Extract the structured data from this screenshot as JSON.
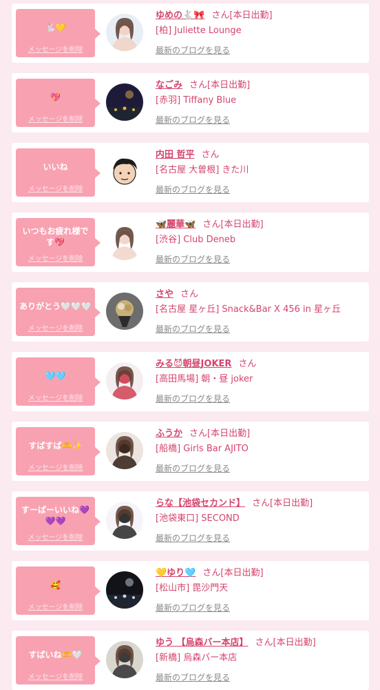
{
  "messages": [
    {
      "message": "🐇💛",
      "name": "ゆめの🐇🎀",
      "honorific": "さん",
      "status": "[本日出勤]",
      "shop": "[柏] Juliette Lounge",
      "avatar": "avatar-photo-woman",
      "bg": "#e8eef6",
      "fg": "#f2d3c6"
    },
    {
      "message": "💖",
      "name": "なごみ",
      "honorific": "さん",
      "status": "[本日出勤]",
      "shop": "[赤羽] Tiffany Blue",
      "avatar": "avatar-photo-dark-night",
      "bg": "#1d1a3a",
      "fg": "#e2b14a"
    },
    {
      "message": "いいね",
      "name": "内田 哲平",
      "honorific": "さん",
      "status": "",
      "shop": "[名古屋 大曽根] きた川",
      "avatar": "avatar-illustration-man",
      "bg": "#ffffff",
      "fg": "#f3d2b8"
    },
    {
      "message": "いつもお疲れ様です💖",
      "name": "🦋麗華🦋",
      "honorific": "さん",
      "status": "[本日出勤]",
      "shop": "[渋谷] Club Deneb",
      "avatar": "avatar-photo-woman-white",
      "bg": "#ffffff",
      "fg": "#f1d6cc"
    },
    {
      "message": "ありがとう🤍🤍🤍",
      "name": "さや",
      "honorific": "さん",
      "status": "",
      "shop": "[名古屋 星ヶ丘] Snack&Bar X 456 in 星ヶ丘",
      "avatar": "avatar-photo-bouquet",
      "bg": "#6d6d6d",
      "fg": "#c7b07a"
    },
    {
      "message": "🩵🩵",
      "name": "みる😈朝昼JOKER",
      "honorific": "さん",
      "status": "",
      "shop": "[高田馬場] 朝・昼 joker",
      "avatar": "avatar-photo-woman-costume",
      "bg": "#f4eef0",
      "fg": "#d34a5c"
    },
    {
      "message": "すばすば🫶✨",
      "name": "ふうか",
      "honorific": "さん",
      "status": "[本日出勤]",
      "shop": "[船橋] Girls Bar AJITO",
      "avatar": "avatar-photo-woman-brown",
      "bg": "#ece4de",
      "fg": "#3c2a22"
    },
    {
      "message": "すーぱーいいね💜💜💜",
      "name": "らな【池袋セカンド】",
      "honorific": "さん",
      "status": "[本日出勤]",
      "shop": "[池袋東口] SECOND",
      "avatar": "avatar-photo-woman-dress",
      "bg": "#f6f4f8",
      "fg": "#333333"
    },
    {
      "message": "🥰",
      "name": "💛ゆり🩵",
      "honorific": "さん",
      "status": "[本日出勤]",
      "shop": "[松山市] 毘沙門天",
      "avatar": "avatar-photo-night-city",
      "bg": "#111318",
      "fg": "#c9d2e4"
    },
    {
      "message": "すばいね🫶🤍",
      "name": "ゆう 【烏森バー本店】",
      "honorific": "さん",
      "status": "[本日出勤]",
      "shop": "[新橋] 烏森バー本店",
      "avatar": "avatar-photo-woman-street",
      "bg": "#d9d6cf",
      "fg": "#3b3b3b"
    }
  ],
  "labels": {
    "delete": "メッセージを削除",
    "blog": "最新のブログを見る"
  }
}
